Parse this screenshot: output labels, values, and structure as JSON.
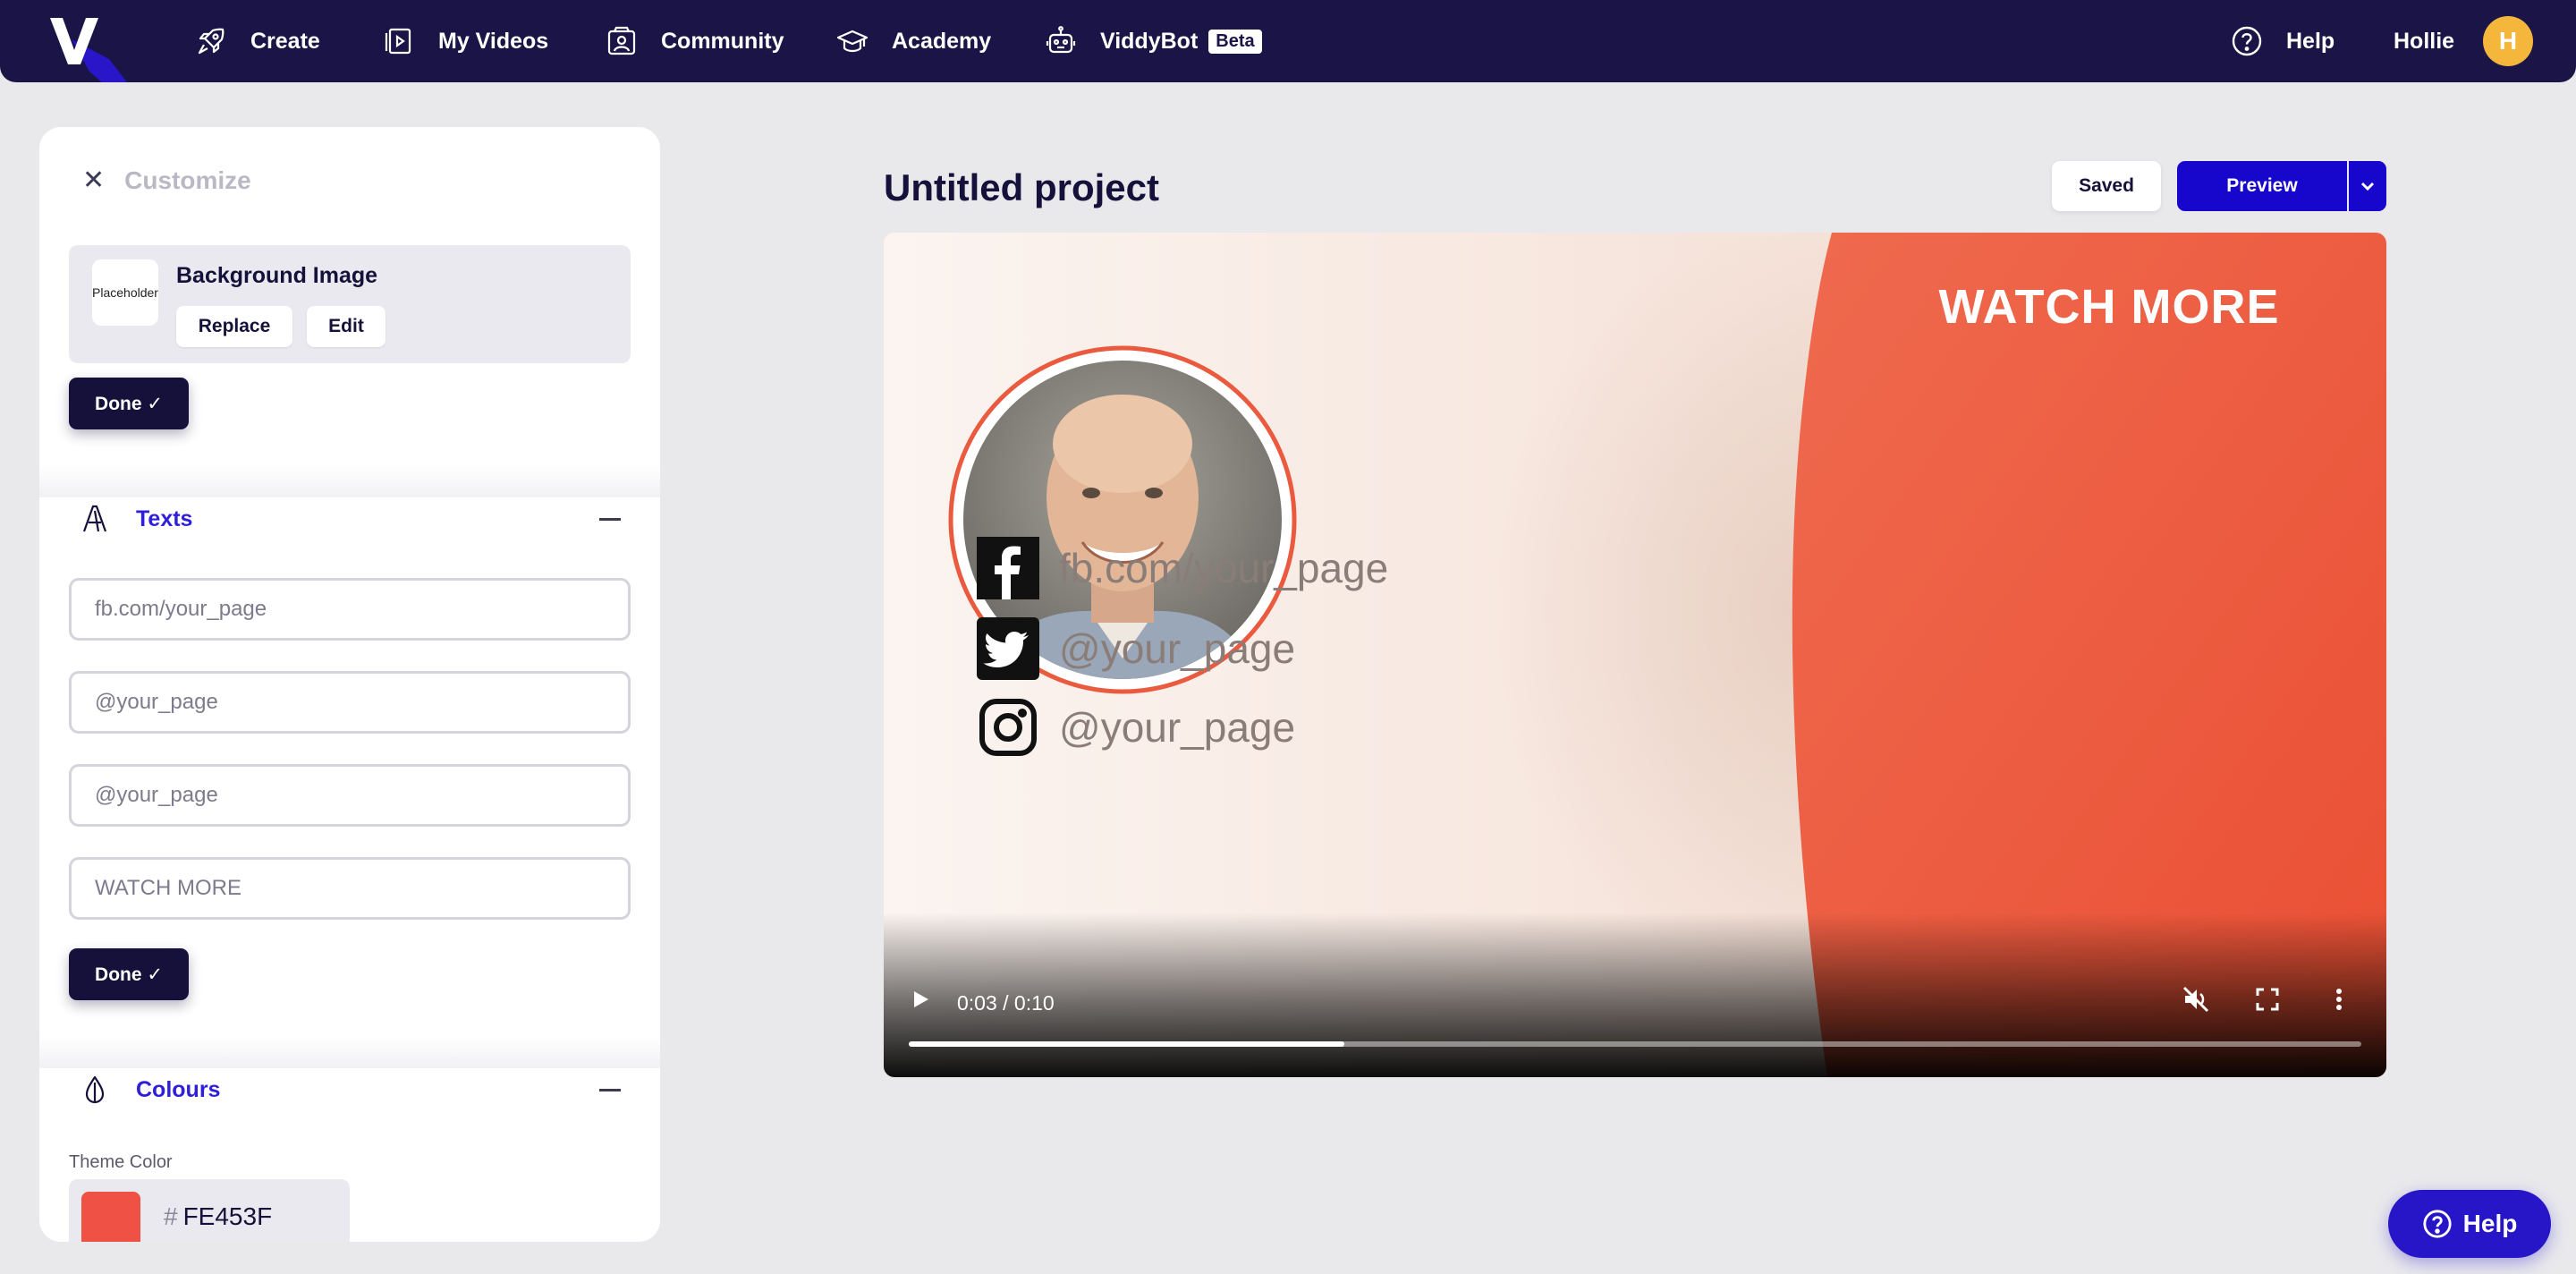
{
  "nav": {
    "logo_letter": "V",
    "items": [
      {
        "label": "Create",
        "icon": "rocket-icon"
      },
      {
        "label": "My Videos",
        "icon": "video-library-icon"
      },
      {
        "label": "Community",
        "icon": "community-icon"
      },
      {
        "label": "Academy",
        "icon": "graduation-cap-icon"
      },
      {
        "label": "ViddyBot",
        "icon": "robot-icon",
        "badge": "Beta"
      }
    ],
    "help_label": "Help",
    "user_name": "Hollie",
    "avatar_initial": "H"
  },
  "panel": {
    "title": "Customize",
    "background": {
      "thumb_text": "Placeholder",
      "label": "Background Image",
      "replace_label": "Replace",
      "edit_label": "Edit"
    },
    "done_label": "Done ✓",
    "texts": {
      "title": "Texts",
      "fields": [
        {
          "placeholder": "fb.com/your_page"
        },
        {
          "placeholder": "@your_page"
        },
        {
          "placeholder": "@your_page"
        },
        {
          "placeholder": "WATCH MORE"
        }
      ]
    },
    "colours": {
      "title": "Colours",
      "theme_label": "Theme Color",
      "hash": "#",
      "hex": "FE453F",
      "swatch_color": "#ef5145"
    }
  },
  "project": {
    "title": "Untitled project",
    "saved_label": "Saved",
    "preview_label": "Preview"
  },
  "video": {
    "headline": "WATCH MORE",
    "socials": [
      {
        "icon": "facebook-icon",
        "text": "fb.com/your_page"
      },
      {
        "icon": "twitter-icon",
        "text": "@your_page"
      },
      {
        "icon": "instagram-icon",
        "text": "@your_page"
      }
    ],
    "time": "0:03 / 0:10",
    "progress_fraction": 0.3,
    "accent": "#f0593d"
  },
  "help_fab_label": "Help"
}
